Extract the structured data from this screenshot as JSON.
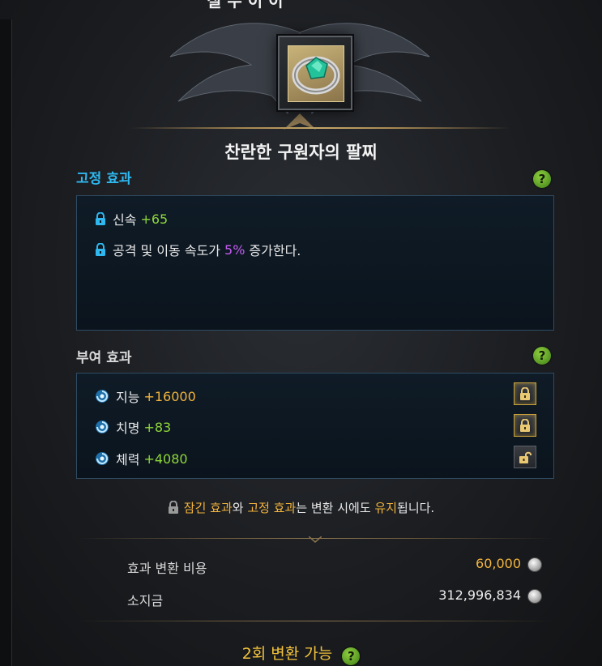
{
  "header": {
    "partial_title": "칠 수 이 이"
  },
  "item": {
    "name": "찬란한 구원자의 팔찌",
    "icon": "bracelet-icon"
  },
  "fixed_effects": {
    "title": "고정 효과",
    "title_color": "#2fb8f0",
    "help": "?",
    "rows": [
      {
        "name": "신속",
        "value": "+65"
      },
      {
        "pre": "공격 및 이동 속도가",
        "highlight": "5%",
        "post": "증가한다."
      }
    ]
  },
  "granted_effects": {
    "title": "부여 효과",
    "help": "?",
    "rows": [
      {
        "name": "지능",
        "value": "+16000",
        "value_color": "#f2b33c",
        "locked": true
      },
      {
        "name": "치명",
        "value": "+83",
        "value_color": "#8fd83a",
        "locked": true
      },
      {
        "name": "체력",
        "value": "+4080",
        "value_color": "#8fd83a",
        "locked": false
      }
    ]
  },
  "notice": {
    "part1": "잠긴 효과",
    "part2": "와 ",
    "part3": "고정 효과",
    "part4": "는 변환 시에도 ",
    "part5": "유지",
    "part6": "됩니다."
  },
  "cost": {
    "label": "효과 변환 비용",
    "value": "60,000",
    "gold_label": "소지금",
    "gold_value": "312,996,834"
  },
  "footer": {
    "count_text": "2회 변환 가능",
    "help": "?"
  },
  "colors": {
    "accent_gold": "#f2b33c",
    "green": "#8fd83a",
    "purple": "#c45cf2"
  }
}
